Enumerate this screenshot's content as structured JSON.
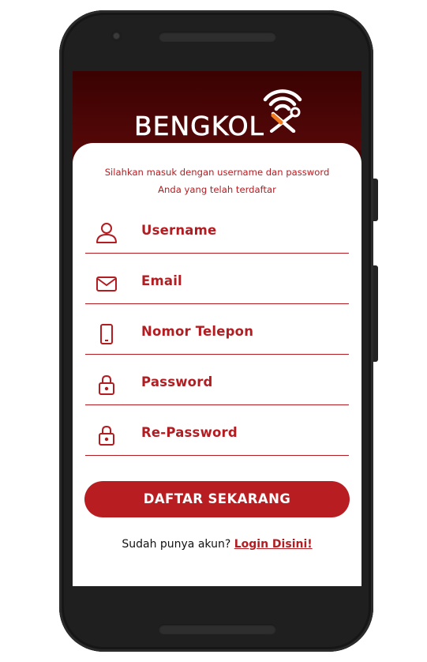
{
  "app": {
    "logo_text": "BENGKOL",
    "brand_color": "#b81d22",
    "header_color": "#4a0404"
  },
  "intro": {
    "line1": "Silahkan masuk dengan username dan password",
    "line2": "Anda yang telah terdaftar"
  },
  "form": {
    "fields": [
      {
        "icon": "user-icon",
        "label": "Username"
      },
      {
        "icon": "email-icon",
        "label": "Email"
      },
      {
        "icon": "phone-icon",
        "label": "Nomor Telepon"
      },
      {
        "icon": "lock-icon",
        "label": "Password"
      },
      {
        "icon": "lock-icon",
        "label": "Re-Password"
      }
    ],
    "submit_label": "DAFTAR SEKARANG"
  },
  "footer": {
    "question": "Sudah punya akun?",
    "link_label": "Login Disini!"
  }
}
